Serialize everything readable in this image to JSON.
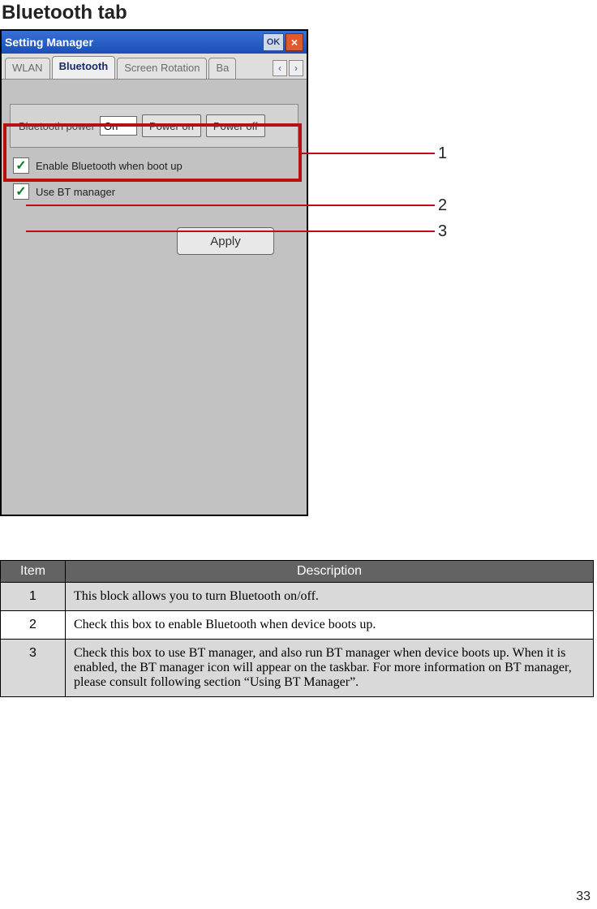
{
  "page": {
    "heading": "Bluetooth tab",
    "number": "33"
  },
  "window": {
    "title": "Setting Manager",
    "ok_label": "OK",
    "close_glyph": "×",
    "tabs": {
      "wlan": "WLAN",
      "bluetooth": "Bluetooth",
      "screen_rotation": "Screen Rotation",
      "more": "Ba",
      "left_arrow": "‹",
      "right_arrow": "›"
    },
    "power": {
      "label": "Bluetooth power",
      "value": "On",
      "power_on": "Power on",
      "power_off": "Power off"
    },
    "check1": {
      "checked_glyph": "✓",
      "label": "Enable Bluetooth when boot up"
    },
    "check2": {
      "checked_glyph": "✓",
      "label": "Use BT manager"
    },
    "apply_label": "Apply"
  },
  "callouts": {
    "c1": "1",
    "c2": "2",
    "c3": "3"
  },
  "table": {
    "head_item": "Item",
    "head_desc": "Description",
    "rows": [
      {
        "num": "1",
        "desc": "This block allows you to turn Bluetooth on/off."
      },
      {
        "num": "2",
        "desc": "Check this box to enable Bluetooth when device boots up."
      },
      {
        "num": "3",
        "desc": "Check this box to use BT manager, and also run BT manager when device boots up. When it is enabled, the BT manager icon will appear on the taskbar. For more information on BT manager, please consult following section “Using BT Manager”."
      }
    ]
  }
}
